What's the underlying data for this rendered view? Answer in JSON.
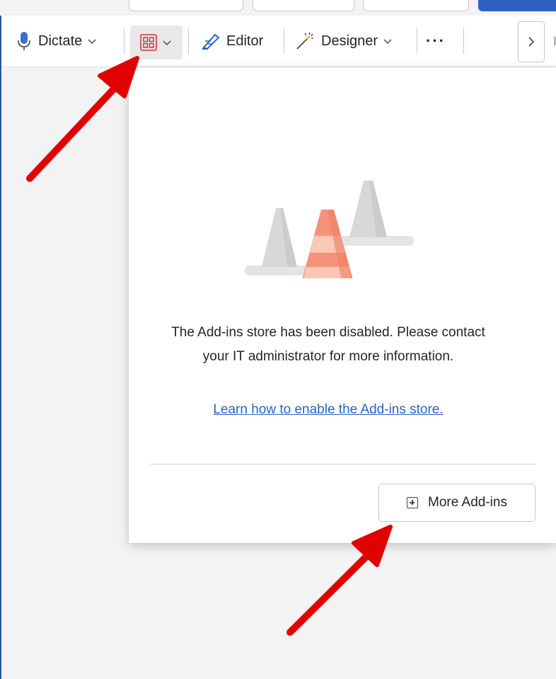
{
  "ribbon": {
    "dictate_label": "Dictate",
    "editor_label": "Editor",
    "designer_label": "Designer",
    "more_label": "···",
    "icons": {
      "dictate": "microphone-icon",
      "addins": "add-ins-grid-icon",
      "editor": "editor-pen-icon",
      "designer": "designer-wand-icon",
      "scroll": "chevron-right-icon"
    }
  },
  "panel": {
    "message": "The Add-ins store has been disabled. Please contact your IT administrator for more information.",
    "learn_link": "Learn how to enable the Add-ins store.",
    "more_addins_label": "More Add-ins",
    "illustration": "traffic-cones-illustration"
  },
  "colors": {
    "accent": "#2b62c4",
    "addins_icon": "#d13438",
    "cone_main": "#f08a70",
    "cone_gray": "#d6d6d6",
    "annotation_arrow": "#e00000"
  }
}
